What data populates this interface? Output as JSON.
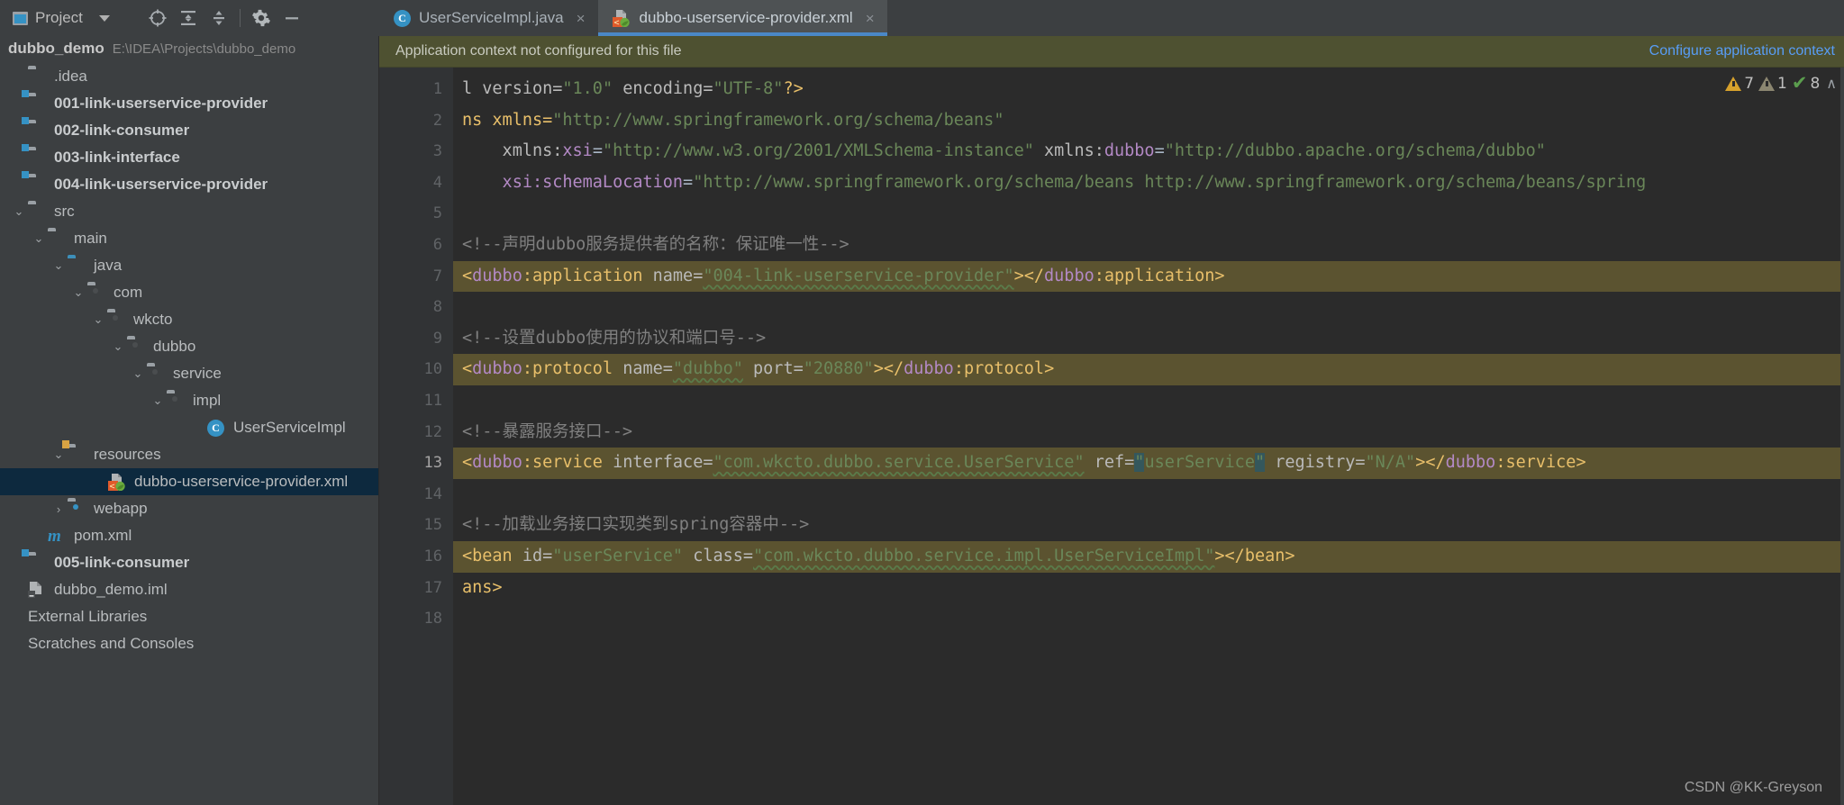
{
  "toolwindow": {
    "title": "Project",
    "icons": [
      "project-icon",
      "chevron-down-icon",
      "locate-icon",
      "expand-all-icon",
      "collapse-all-icon",
      "gear-icon",
      "minimize-icon"
    ]
  },
  "project": {
    "name": "dubbo_demo",
    "path": "E:\\IDEA\\Projects\\dubbo_demo"
  },
  "tree": [
    {
      "label": ".idea",
      "indent": 0,
      "arrow": "none",
      "icon": "folder",
      "bold": false,
      "selected": false
    },
    {
      "label": "001-link-userservice-provider",
      "indent": 0,
      "arrow": "none",
      "icon": "folder-module",
      "bold": true,
      "selected": false
    },
    {
      "label": "002-link-consumer",
      "indent": 0,
      "arrow": "none",
      "icon": "folder-module",
      "bold": true,
      "selected": false
    },
    {
      "label": "003-link-interface",
      "indent": 0,
      "arrow": "none",
      "icon": "folder-module",
      "bold": true,
      "selected": false
    },
    {
      "label": "004-link-userservice-provider",
      "indent": 0,
      "arrow": "none",
      "icon": "folder-module",
      "bold": true,
      "selected": false
    },
    {
      "label": "src",
      "indent": 1,
      "arrow": "expanded",
      "icon": "folder",
      "bold": false,
      "selected": false
    },
    {
      "label": "main",
      "indent": 2,
      "arrow": "expanded",
      "icon": "folder",
      "bold": false,
      "selected": false
    },
    {
      "label": "java",
      "indent": 3,
      "arrow": "expanded",
      "icon": "folder-source",
      "bold": false,
      "selected": false
    },
    {
      "label": "com",
      "indent": 4,
      "arrow": "expanded",
      "icon": "folder-package",
      "bold": false,
      "selected": false
    },
    {
      "label": "wkcto",
      "indent": 5,
      "arrow": "expanded",
      "icon": "folder-package",
      "bold": false,
      "selected": false
    },
    {
      "label": "dubbo",
      "indent": 6,
      "arrow": "expanded",
      "icon": "folder-package",
      "bold": false,
      "selected": false
    },
    {
      "label": "service",
      "indent": 7,
      "arrow": "expanded",
      "icon": "folder-package",
      "bold": false,
      "selected": false
    },
    {
      "label": "impl",
      "indent": 8,
      "arrow": "expanded",
      "icon": "folder-package",
      "bold": false,
      "selected": false
    },
    {
      "label": "UserServiceImpl",
      "indent": 9,
      "arrow": "none",
      "icon": "java-class",
      "bold": false,
      "selected": false
    },
    {
      "label": "resources",
      "indent": 3,
      "arrow": "expanded",
      "icon": "folder-resources",
      "bold": false,
      "selected": false
    },
    {
      "label": "dubbo-userservice-provider.xml",
      "indent": 5,
      "arrow": "none",
      "icon": "spring-xml",
      "bold": false,
      "selected": true
    },
    {
      "label": "webapp",
      "indent": 2,
      "arrow": "collapsed",
      "icon": "folder-web",
      "bold": false,
      "selected": false
    },
    {
      "label": "pom.xml",
      "indent": 2,
      "arrow": "none",
      "icon": "maven",
      "bold": false,
      "selected": false
    },
    {
      "label": "005-link-consumer",
      "indent": 0,
      "arrow": "none",
      "icon": "folder-module",
      "bold": true,
      "selected": false
    },
    {
      "label": "dubbo_demo.iml",
      "indent": 0,
      "arrow": "none",
      "icon": "iml",
      "bold": false,
      "selected": false
    },
    {
      "label": "External Libraries",
      "indent": 0,
      "arrow": "none",
      "icon": "none",
      "bold": false,
      "selected": false
    },
    {
      "label": "Scratches and Consoles",
      "indent": 0,
      "arrow": "none",
      "icon": "none",
      "bold": false,
      "selected": false
    }
  ],
  "tabs": [
    {
      "label": "UserServiceImpl.java",
      "icon": "java-class-icon",
      "active": false,
      "close": "×"
    },
    {
      "label": "dubbo-userservice-provider.xml",
      "icon": "spring-xml-icon",
      "active": true,
      "close": "×"
    }
  ],
  "notification": {
    "message": "Application context not configured for this file",
    "action": "Configure application context"
  },
  "inspection": {
    "warnings": "7",
    "weak_warnings": "1",
    "ok_count": "8",
    "chevron": "∧"
  },
  "editor": {
    "line_numbers": [
      "1",
      "2",
      "3",
      "4",
      "5",
      "6",
      "7",
      "8",
      "9",
      "10",
      "11",
      "12",
      "13",
      "14",
      "15",
      "16",
      "17",
      "18"
    ],
    "current_line": 13,
    "lines": [
      {
        "n": 1,
        "highlight": false,
        "text": "l version=\"1.0\" encoding=\"UTF-8\"?>"
      },
      {
        "n": 2,
        "highlight": false,
        "text": "ns xmlns=\"http://www.springframework.org/schema/beans\""
      },
      {
        "n": 3,
        "highlight": false,
        "text": "    xmlns:xsi=\"http://www.w3.org/2001/XMLSchema-instance\" xmlns:dubbo=\"http://dubbo.apache.org/schema/dubbo\""
      },
      {
        "n": 4,
        "highlight": false,
        "text": "    xsi:schemaLocation=\"http://www.springframework.org/schema/beans http://www.springframework.org/schema/beans/spring"
      },
      {
        "n": 5,
        "highlight": false,
        "text": ""
      },
      {
        "n": 6,
        "highlight": false,
        "text": "<!--声明dubbo服务提供者的名称：保证唯一性-->"
      },
      {
        "n": 7,
        "highlight": true,
        "text": "<dubbo:application name=\"004-link-userservice-provider\"></dubbo:application>"
      },
      {
        "n": 8,
        "highlight": false,
        "text": ""
      },
      {
        "n": 9,
        "highlight": false,
        "text": "<!--设置dubbo使用的协议和端口号-->"
      },
      {
        "n": 10,
        "highlight": true,
        "text": "<dubbo:protocol name=\"dubbo\" port=\"20880\"></dubbo:protocol>"
      },
      {
        "n": 11,
        "highlight": false,
        "text": ""
      },
      {
        "n": 12,
        "highlight": false,
        "text": "<!--暴露服务接口-->"
      },
      {
        "n": 13,
        "highlight": true,
        "text": "<dubbo:service interface=\"com.wkcto.dubbo.service.UserService\" ref=\"userService\" registry=\"N/A\"></dubbo:service>"
      },
      {
        "n": 14,
        "highlight": false,
        "text": ""
      },
      {
        "n": 15,
        "highlight": false,
        "text": "<!--加载业务接口实现类到spring容器中-->"
      },
      {
        "n": 16,
        "highlight": true,
        "text": "<bean id=\"userService\" class=\"com.wkcto.dubbo.service.impl.UserServiceImpl\"></bean>"
      },
      {
        "n": 17,
        "highlight": false,
        "text": "ans>"
      },
      {
        "n": 18,
        "highlight": false,
        "text": ""
      }
    ],
    "line1": {
      "a": "l version=",
      "b": "\"1.0\"",
      "c": " encoding=",
      "d": "\"UTF-8\"",
      "e": "?>"
    },
    "line2": {
      "a": "ns xmlns=",
      "b": "\"http://www.springframework.org/schema/beans\""
    },
    "line3": {
      "a": "    xmlns:",
      "b": "xsi",
      "c": "=",
      "d": "\"http://www.w3.org/2001/XMLSchema-instance\"",
      "e": " xmlns:",
      "f": "dubbo",
      "g": "=",
      "h": "\"http://dubbo.apache.org/schema/dubbo\""
    },
    "line4": {
      "a": "    xsi:schemaLocation",
      "b": "=",
      "c": "\"http://www.springframework.org/schema/beans http://www.springframework.org/schema/beans/spring"
    },
    "line6": {
      "a": "<!--声明dubbo服务提供者的名称：保证唯一性-->"
    },
    "line7": {
      "a": "<",
      "b": "dubbo",
      "c": ":application",
      "d": " name=",
      "e": "\"004-link-userservice-provider\"",
      "f": "></",
      "g": "dubbo",
      "h": ":application",
      "i": ">"
    },
    "line9": {
      "a": "<!--设置dubbo使用的协议和端口号-->"
    },
    "line10": {
      "a": "<",
      "b": "dubbo",
      "c": ":protocol",
      "d": " name=",
      "e": "\"dubbo\"",
      "f": " port=",
      "g": "\"20880\"",
      "h": "></",
      "i": "dubbo",
      "j": ":protocol",
      "k": ">"
    },
    "line12": {
      "a": "<!--暴露服务接口-->"
    },
    "line13": {
      "a": "<",
      "b": "dubbo",
      "c": ":service",
      "d": " interface=",
      "e": "\"com.wkcto.dubbo.service.UserService\"",
      "f": " ref=",
      "g": "\"",
      "h": "userService",
      "i": "\"",
      "j": " registry=",
      "k": "\"N/A\"",
      "l": "></",
      "m": "dubbo",
      "n": ":service",
      "o": ">"
    },
    "line15": {
      "a": "<!--加载业务接口实现类到spring容器中-->"
    },
    "line16": {
      "a": "<",
      "b": "bean",
      "c": " id=",
      "d": "\"userService\"",
      "e": " class=",
      "f": "\"com.wkcto.dubbo.service.impl.UserServiceImpl\"",
      "g": "></",
      "h": "bean",
      "i": ">"
    },
    "line17": {
      "a": "ans>"
    }
  },
  "watermark": "CSDN @KK-Greyson",
  "colors": {
    "bg_editor": "#2b2b2b",
    "bg_gutter": "#313335",
    "bg_panel": "#3c3f41",
    "bg_tab_active": "#4e5254",
    "tab_underline": "#4a88c7",
    "notification_bg": "#4e5131",
    "link": "#589df6",
    "selection": "#0d293e",
    "highlight_line": "#5b5330",
    "string": "#6a8759",
    "tag": "#e8bf6a",
    "namespace": "#b389c5",
    "comment": "#808080",
    "accent_blue": "#3592c4",
    "warning": "#d6a12c",
    "ok_green": "#5b9e4e"
  }
}
